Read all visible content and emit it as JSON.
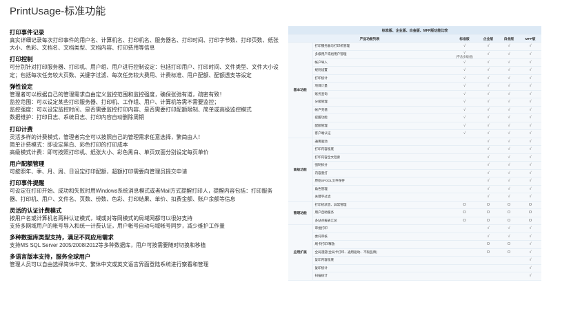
{
  "title": "PrintUsage-标准功能",
  "features": [
    {
      "heading": "打印事件记录",
      "lines": [
        "真实详细记录每次打印事件的用户名、计算机名、打印机名、服务器名、打印时间、打印字节数、打印页数、纸张大小、色彩、文档名、文档类型、文档内容、打印费用等信息"
      ]
    },
    {
      "heading": "打印控制",
      "lines": [
        "可分别针对打印服务器、打印机、用户组、用户进行控制设定：包括打印用户、打印时间、文件类型、文件大小设定；包括每次任务较大页数、关键字过滤、每次任务较大费用、计费标准、用户配额、配额透支等设定"
      ]
    },
    {
      "heading": "弹性设定",
      "lines": [
        "管理者可以根据自己的管理需求自由定义监控范围和监控强度，确保张弛有道，疏密有致！",
        "监控范围：可以设定某些打印服务器、打印机、工作组、用户、计算机等需不需要监控；",
        "监控强度：可以设定监控时间、是否需要监控打印内容、是否需要打印配额限制、简单或高级监控模式",
        "数据维护：打印日志、系统日志、打印内容自动删除周期"
      ]
    },
    {
      "heading": "打印计费",
      "lines": [
        "灵活多样的计费模式，管理者完全可以按照自己的管理需求任意选择，繁简由人！",
        "简单计费模式：即设定黑白、彩色打印的打印成本",
        "高级模式计费：即可按照打印机、纸张大小、彩色黑白、单页双面分别设定每页单价"
      ]
    },
    {
      "heading": "用户配额管理",
      "lines": [
        "可按照年、季、月、周、日设定打印配额，超额打印需要向管理员提交申请"
      ]
    },
    {
      "heading": "打印事件提醒",
      "lines": [
        "可设定在打印开始、成功和失败时用Windows系统消息模式或者Mail方式提醒打印人，提醒内容包括：打印服务器、打印机、用户、文件名、页数、份数、色彩、打印结果、单价、扣费金额、账户余额等信息"
      ]
    },
    {
      "heading": "灵活的认证计费模式",
      "lines": [
        "按用户名或计算机名两种认证模式，域或对等网模式的局域网都可以很好支持",
        "支持多网域用户的帐号导入和统一计费认证，用户帐号自动与域帐号同步，减少维护工作量"
      ]
    },
    {
      "heading": "多种数据库类型支持，满足不同应用需求",
      "lines": [
        "支持MS SQL Server 2005/2008/2012等多种数据库，用户可按需要随时切换和移植"
      ]
    },
    {
      "heading": "多语言版本支持，服务全球用户",
      "lines": [
        "管理人员可以自由选择简体中文、繁体中文或英文语言界面登陆系统进行察看和管理"
      ]
    }
  ],
  "table": {
    "caption": "标准版、企业版、白金版、MFP版功能比较",
    "headers": [
      "产品功能列表",
      "标准版",
      "企业版",
      "白金版",
      "MFP版"
    ],
    "groups": [
      {
        "name": "基本功能",
        "rows": [
          {
            "feature": "打印服务器与打印机管理",
            "marks": [
              "√",
              "√",
              "√",
              "√"
            ]
          },
          {
            "feature": "多级用户或组用户管理",
            "marks": [
              "√",
              "√",
              "√",
              "√"
            ],
            "note": "(不含多级组)"
          },
          {
            "feature": "帐户导入",
            "marks": [
              "√",
              "√",
              "√",
              "√"
            ]
          },
          {
            "feature": "规则设置",
            "marks": [
              "√",
              "√",
              "√",
              "√"
            ]
          },
          {
            "feature": "打印统计",
            "marks": [
              "√",
              "√",
              "√",
              "√"
            ]
          },
          {
            "feature": "项目计量",
            "marks": [
              "√",
              "√",
              "√",
              "√"
            ]
          },
          {
            "feature": "账务查询",
            "marks": [
              "√",
              "√",
              "√",
              "√"
            ]
          },
          {
            "feature": "分级管理",
            "marks": [
              "√",
              "√",
              "√",
              "√"
            ]
          },
          {
            "feature": "帐户充值",
            "marks": [
              "√",
              "√",
              "√",
              "√"
            ]
          },
          {
            "feature": "提醒功能",
            "marks": [
              "√",
              "√",
              "√",
              "√"
            ]
          },
          {
            "feature": "配额管理",
            "marks": [
              "√",
              "√",
              "√",
              "√"
            ]
          },
          {
            "feature": "客户端认证",
            "marks": [
              "√",
              "√",
              "√",
              "√"
            ]
          }
        ]
      },
      {
        "name": "高级功能",
        "rows": [
          {
            "feature": "通用驱动",
            "marks": [
              "",
              "√",
              "√",
              "√"
            ]
          },
          {
            "feature": "打印内容留底",
            "marks": [
              "",
              "√",
              "√",
              "√"
            ]
          },
          {
            "feature": "打印内容全文检索",
            "marks": [
              "",
              "√",
              "√",
              "√"
            ]
          },
          {
            "feature": "强制拆分",
            "marks": [
              "",
              "√",
              "√",
              "√"
            ]
          },
          {
            "feature": "内容重打",
            "marks": [
              "",
              "√",
              "√",
              "√"
            ]
          },
          {
            "feature": "原始SPOOL文件保存",
            "marks": [
              "",
              "√",
              "√",
              "√"
            ]
          },
          {
            "feature": "角色管理",
            "marks": [
              "",
              "√",
              "√",
              "√"
            ]
          },
          {
            "feature": "关键字过滤",
            "marks": [
              "",
              "√",
              "√",
              "√"
            ]
          }
        ]
      },
      {
        "name": "管理功能",
        "rows": [
          {
            "feature": "打印机状态、异常管理",
            "marks": [
              "O",
              "O",
              "O",
              "O"
            ]
          },
          {
            "feature": "用户自助服务",
            "marks": [
              "O",
              "O",
              "O",
              "O"
            ]
          },
          {
            "feature": "多站点报表汇总",
            "marks": [
              "O",
              "O",
              "O",
              "O"
            ]
          }
        ]
      },
      {
        "name": "应用扩展",
        "rows": [
          {
            "feature": "审批打印",
            "marks": [
              "",
              "√",
              "√",
              "√"
            ]
          },
          {
            "feature": "委托审核",
            "marks": [
              "",
              "√",
              "√",
              "√"
            ]
          },
          {
            "feature": "刷卡打印/释放",
            "marks": [
              "",
              "O",
              "O",
              "√"
            ]
          },
          {
            "feature": "全局漫游(全局卡打印、通用驱动、不限品牌)",
            "marks": [
              "",
              "O",
              "O",
              "√"
            ]
          },
          {
            "feature": "复印内容留底",
            "marks": [
              "",
              "",
              "",
              "√"
            ]
          },
          {
            "feature": "复印统计",
            "marks": [
              "",
              "",
              "",
              "√"
            ]
          },
          {
            "feature": "扫描统计",
            "marks": [
              "",
              "",
              "",
              "√"
            ]
          }
        ]
      }
    ]
  }
}
